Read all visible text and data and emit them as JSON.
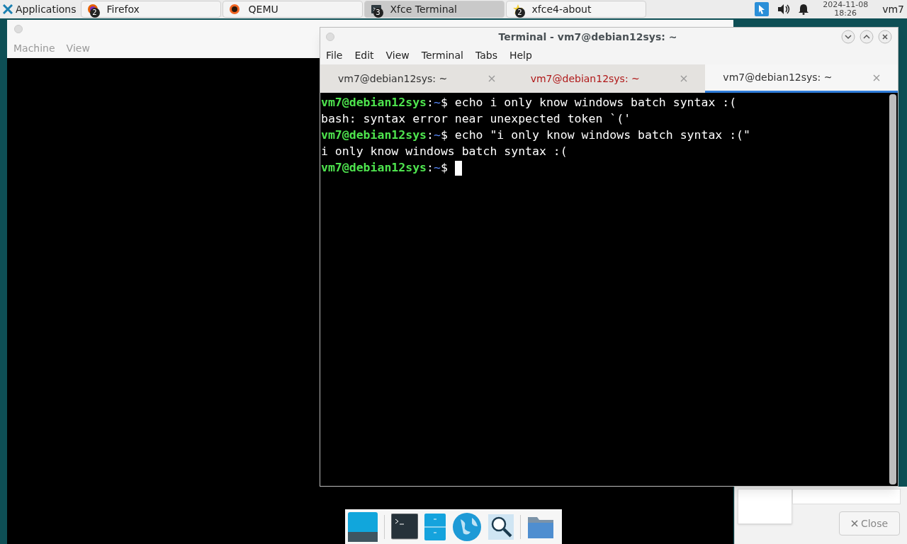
{
  "panel": {
    "apps_label": "Applications",
    "tasks": [
      {
        "label": "Firefox",
        "badge": "2",
        "selected": false
      },
      {
        "label": "QEMU",
        "selected": false
      },
      {
        "label": "Xfce Terminal",
        "badge": "3",
        "selected": true
      },
      {
        "label": "xfce4-about",
        "badge": "2",
        "selected": false
      }
    ],
    "date": "2024-11-08",
    "time": "18:26",
    "user": "vm7"
  },
  "qemu_window": {
    "menu": [
      {
        "label": "Machine",
        "disabled": true
      },
      {
        "label": "View",
        "disabled": true
      }
    ]
  },
  "terminal_window": {
    "title": "Terminal - vm7@debian12sys: ~",
    "menu": [
      "File",
      "Edit",
      "View",
      "Terminal",
      "Tabs",
      "Help"
    ],
    "tabs": [
      {
        "label": "vm7@debian12sys: ~",
        "selected": false,
        "activity": false
      },
      {
        "label": "vm7@debian12sys: ~",
        "selected": false,
        "activity": true
      },
      {
        "label": "vm7@debian12sys: ~",
        "selected": true,
        "activity": false
      }
    ],
    "lines": [
      {
        "kind": "prompt",
        "user": "vm7@debian12sys",
        "sep": ":",
        "path": "~",
        "sign": "$",
        "command": "echo i only know windows batch syntax :("
      },
      {
        "kind": "output",
        "text": "bash: syntax error near unexpected token `('"
      },
      {
        "kind": "prompt",
        "user": "vm7@debian12sys",
        "sep": ":",
        "path": "~",
        "sign": "$",
        "command": "echo \"i only know windows batch syntax :(\""
      },
      {
        "kind": "output",
        "text": "i only know windows batch syntax :("
      },
      {
        "kind": "prompt",
        "user": "vm7@debian12sys",
        "sep": ":",
        "path": "~",
        "sign": "$",
        "cursor": true
      }
    ]
  },
  "about_window": {
    "close_label": "Close"
  }
}
